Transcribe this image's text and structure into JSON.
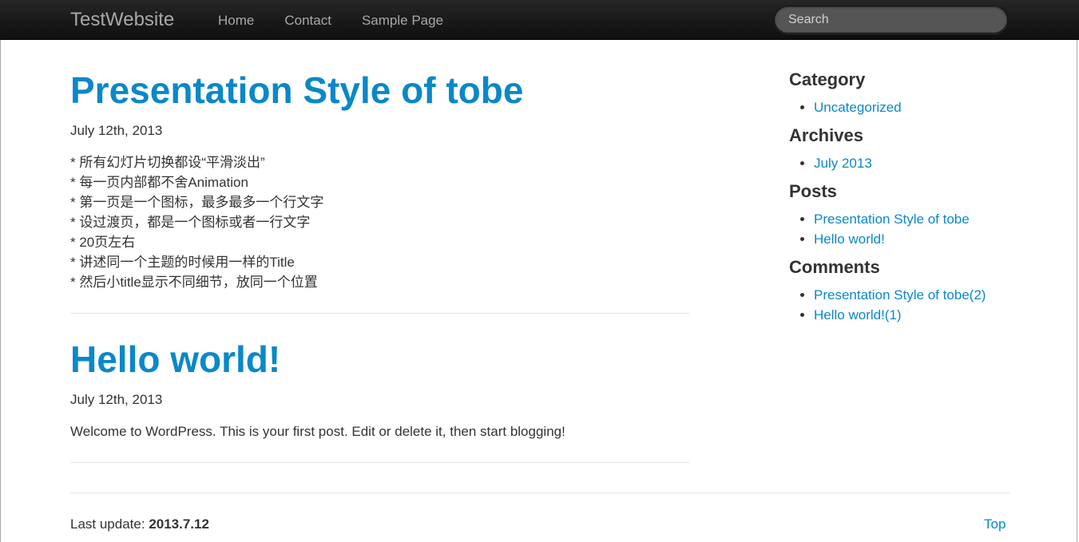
{
  "navbar": {
    "brand": "TestWebsite",
    "links": [
      "Home",
      "Contact",
      "Sample Page"
    ],
    "search_placeholder": "Search"
  },
  "posts": [
    {
      "title": "Presentation Style of tobe",
      "date": "July 12th, 2013",
      "body": [
        "* 所有幻灯片切换都设“平滑淡出”",
        "* 每一页内部都不舍Animation",
        "* 第一页是一个图标，最多最多一个行文字",
        "* 设过渡页，都是一个图标或者一行文字",
        "* 20页左右",
        "* 讲述同一个主题的时候用一样的Title",
        "* 然后小title显示不同细节，放同一个位置"
      ]
    },
    {
      "title": "Hello world!",
      "date": "July 12th, 2013",
      "body": [
        "Welcome to WordPress. This is your first post. Edit or delete it, then start blogging!"
      ]
    }
  ],
  "sidebar": {
    "sections": [
      {
        "heading": "Category",
        "items": [
          "Uncategorized"
        ]
      },
      {
        "heading": "Archives",
        "items": [
          "July 2013"
        ]
      },
      {
        "heading": "Posts",
        "items": [
          "Presentation Style of tobe",
          "Hello world!"
        ]
      },
      {
        "heading": "Comments",
        "items": [
          "Presentation Style of tobe(2)",
          "Hello world!(1)"
        ]
      }
    ]
  },
  "footer": {
    "last_update_label": "Last update:",
    "last_update_value": "2013.7.12",
    "top_link": "Top"
  },
  "colors": {
    "link": "#0a88c8",
    "navbar_bg": "#1b1b1b",
    "text": "#333333"
  }
}
